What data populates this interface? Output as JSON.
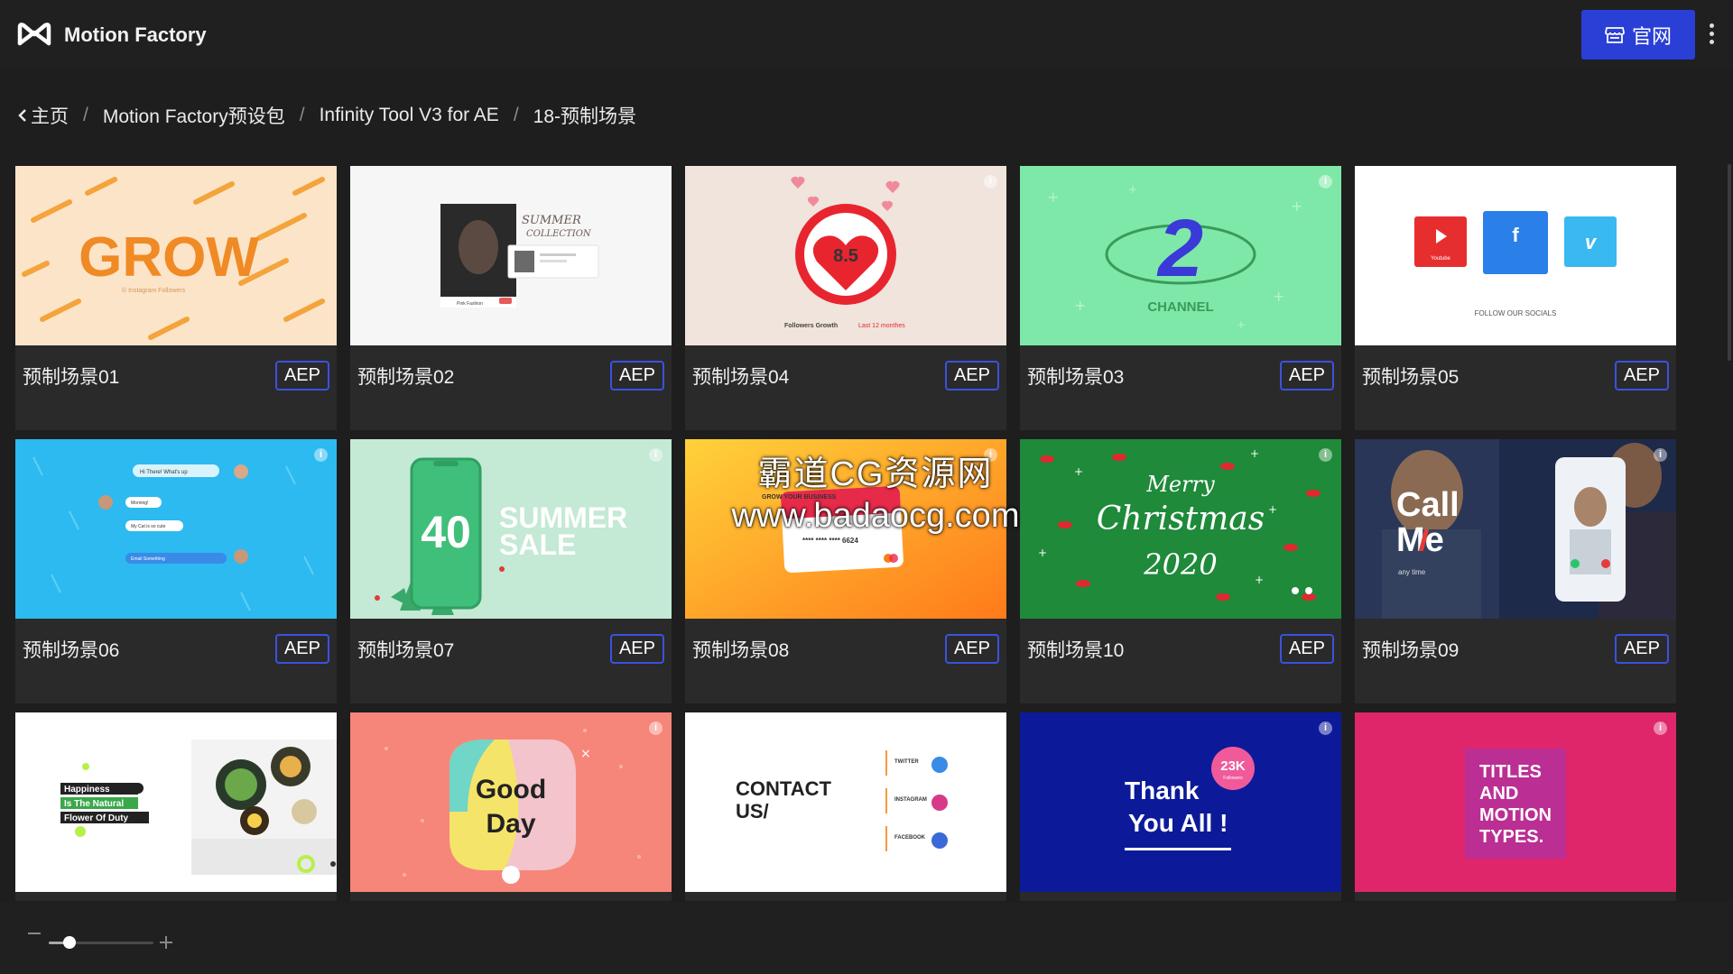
{
  "header": {
    "app_title": "Motion Factory",
    "logo_icon": "infinity-m-logo",
    "site_button_label": "官网",
    "site_button_icon": "storefront-icon",
    "accent_color": "#2a3fd6"
  },
  "breadcrumb": {
    "items": [
      "主页",
      "Motion Factory预设包",
      "Infinity Tool V3 for AE",
      "18-预制场景"
    ],
    "separator": "/"
  },
  "watermark": {
    "line1": "霸道CG资源网",
    "line2": "www.badaocg.com"
  },
  "zoom": {
    "level": 0.2
  },
  "cards": [
    {
      "name": "预制场景01",
      "badge": "AEP",
      "thumb_text": [
        "GROW",
        "© Instagram Followers"
      ]
    },
    {
      "name": "预制场景02",
      "badge": "AEP",
      "thumb_text": [
        "SUMMER",
        "COLLECTION",
        "Pink Fashion"
      ]
    },
    {
      "name": "预制场景04",
      "badge": "AEP",
      "thumb_text": [
        "8.5",
        "Followers Growth",
        "Last 12 monthes"
      ]
    },
    {
      "name": "预制场景03",
      "badge": "AEP",
      "thumb_text": [
        "2",
        "CHANNEL"
      ]
    },
    {
      "name": "预制场景05",
      "badge": "AEP",
      "thumb_text": [
        "Youtube",
        "f",
        "v",
        "FOLLOW OUR SOCIALS"
      ]
    },
    {
      "name": "预制场景06",
      "badge": "AEP",
      "thumb_text": [
        "Hi There! What's up",
        "Morning!",
        "My Cat is so cute",
        "Email Something"
      ]
    },
    {
      "name": "预制场景07",
      "badge": "AEP",
      "thumb_text": [
        "40",
        "SUMMER",
        "SALE"
      ]
    },
    {
      "name": "预制场景08",
      "badge": "AEP",
      "thumb_text": [
        "GROW YOUR BUSINESS",
        "**** **** **** 6624"
      ]
    },
    {
      "name": "预制场景10",
      "badge": "AEP",
      "thumb_text": [
        "Merry",
        "Christmas",
        "2020"
      ]
    },
    {
      "name": "预制场景09",
      "badge": "AEP",
      "thumb_text": [
        "Call",
        "Me",
        "any time"
      ]
    },
    {
      "name": "",
      "badge": "",
      "thumb_text": [
        "Happiness",
        "Is The Natural",
        "Flower Of Duty"
      ]
    },
    {
      "name": "",
      "badge": "",
      "thumb_text": [
        "Good",
        "Day"
      ]
    },
    {
      "name": "",
      "badge": "",
      "thumb_text": [
        "CONTACT",
        "US/",
        "TWITTER",
        "INSTAGRAM",
        "FACEBOOK"
      ]
    },
    {
      "name": "",
      "badge": "",
      "thumb_text": [
        "Thank",
        "You All !",
        "23K",
        "Followers"
      ]
    },
    {
      "name": "",
      "badge": "",
      "thumb_text": [
        "TITLES",
        "AND",
        "MOTION",
        "TYPES."
      ]
    }
  ]
}
